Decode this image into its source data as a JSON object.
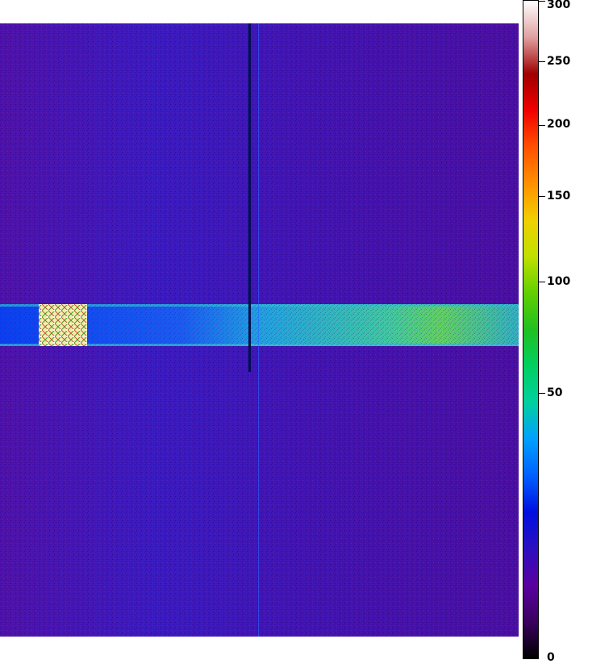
{
  "colorbar": {
    "ticks": [
      {
        "value": 300,
        "label": "300"
      },
      {
        "value": 250,
        "label": "250"
      },
      {
        "value": 200,
        "label": "200"
      },
      {
        "value": 150,
        "label": "150"
      },
      {
        "value": 100,
        "label": "100"
      },
      {
        "value": 50,
        "label": "50"
      },
      {
        "value": 0,
        "label": "0"
      }
    ],
    "colors": [
      "#000000",
      "#3a0060",
      "#5a00a0",
      "#2c0fc0",
      "#0010e0",
      "#0060ff",
      "#00a0ff",
      "#00d0a0",
      "#00d060",
      "#20c020",
      "#60d000",
      "#c0e000",
      "#f0d000",
      "#ff9000",
      "#ff5000",
      "#f00000",
      "#a00000",
      "#e0a0a0",
      "#ffffff"
    ]
  },
  "image": {
    "background_color": "#4a0fa0",
    "band_color_left": "#1a3ff0",
    "band_color_right": "#40d080",
    "hot_region_color": "#f0e0a0",
    "column_color": "#001050"
  }
}
